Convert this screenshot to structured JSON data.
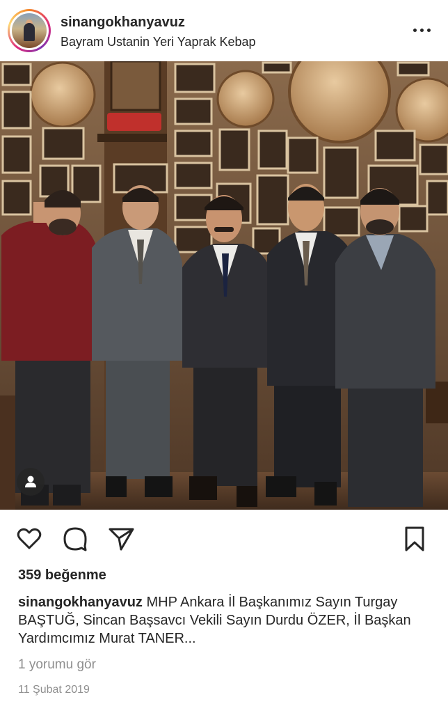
{
  "post": {
    "username": "sinangokhanyavuz",
    "location": "Bayram Ustanin Yeri Yaprak Kebap",
    "more_icon": "more-horizontal-icon",
    "likes": "359 beğenme",
    "caption_username": "sinangokhanyavuz",
    "caption_text": "MHP Ankara İl Başkanımız Sayın Turgay BAŞTUĞ, Sincan Başsavcı Vekili Sayın Durdu ÖZER, İl Başkan Yardımcımız Murat TANER...",
    "view_comments": "1 yorumu gör",
    "date": "11 Şubat 2019"
  },
  "actions": {
    "like_icon": "heart-icon",
    "comment_icon": "comment-icon",
    "share_icon": "send-icon",
    "save_icon": "bookmark-icon",
    "tags_icon": "user-tag-icon"
  },
  "colors": {
    "text": "#262626",
    "muted": "#8e8e8e",
    "story_ring": [
      "#f58529",
      "#dd2a7b",
      "#8134af",
      "#feda77"
    ]
  }
}
